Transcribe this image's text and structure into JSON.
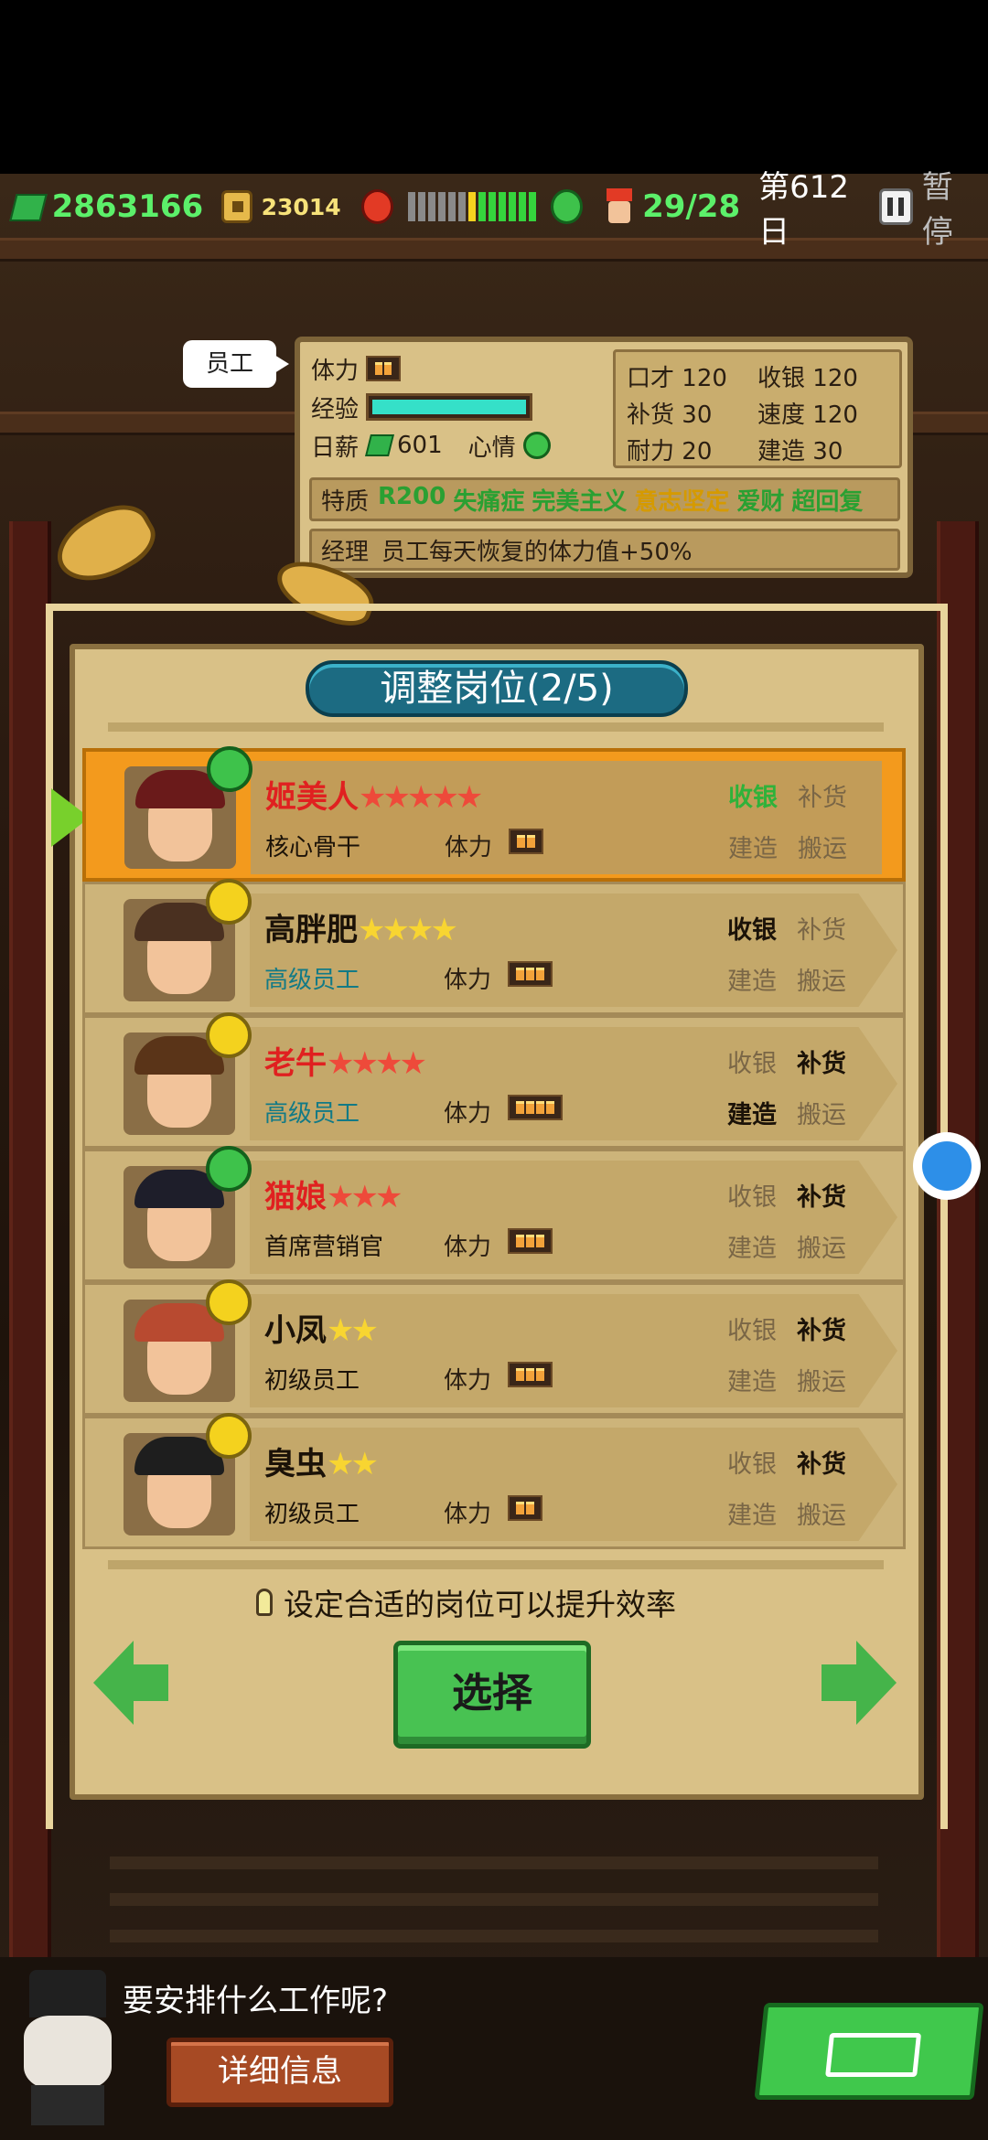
{
  "hud": {
    "money": "2863166",
    "coins": "23014",
    "staff_count": "29/28",
    "day": "第612日",
    "pause_label": "暂停"
  },
  "staff_tag": "员工",
  "info": {
    "stamina_label": "体力",
    "exp_label": "经验",
    "exp_fraction": 1.0,
    "salary_label": "日薪",
    "salary": "601",
    "mood_label": "心情",
    "stats": [
      {
        "label": "口才",
        "value": "120"
      },
      {
        "label": "收银",
        "value": "120"
      },
      {
        "label": "补货",
        "value": "30"
      },
      {
        "label": "速度",
        "value": "120"
      },
      {
        "label": "耐力",
        "value": "20"
      },
      {
        "label": "建造",
        "value": "30"
      }
    ],
    "traits_label": "特质",
    "traits": [
      {
        "text": "R200",
        "color": "#2aa032"
      },
      {
        "text": "失痛症",
        "color": "#2aa032"
      },
      {
        "text": "完美主义",
        "color": "#2aa032"
      },
      {
        "text": "意志坚定",
        "color": "#d59a00"
      },
      {
        "text": "爱财",
        "color": "#2aa032"
      },
      {
        "text": "超回复",
        "color": "#2aa032"
      }
    ],
    "manager_label": "经理",
    "manager_text": "员工每天恢复的体力值+50%"
  },
  "panel": {
    "title": "调整岗位(2/5)",
    "hint": "设定合适的岗位可以提升效率",
    "select_label": "选择"
  },
  "stamina_label": "体力",
  "jobs": [
    "收银",
    "补货",
    "建造",
    "搬运"
  ],
  "employees": [
    {
      "name": "姬美人",
      "name_color": "#e02020",
      "stars": "★★★★★",
      "star_color": "red",
      "rank": "核心骨干",
      "rank_color": "#1b1208",
      "stamina": 2,
      "mood": "happy",
      "active": [
        "on-green",
        "",
        "",
        ""
      ],
      "hair": "#6a1a1a"
    },
    {
      "name": "高胖肥",
      "name_color": "#1b1208",
      "stars": "★★★★",
      "star_color": "yellow",
      "rank": "高级员工",
      "rank_color": "#127a86",
      "stamina": 3,
      "mood": "neutral",
      "active": [
        "on",
        "",
        "",
        ""
      ],
      "hair": "#4a3020"
    },
    {
      "name": "老牛",
      "name_color": "#e02020",
      "stars": "★★★★",
      "star_color": "red",
      "rank": "高级员工",
      "rank_color": "#127a86",
      "stamina": 4,
      "mood": "neutral",
      "active": [
        "",
        "on",
        "on",
        ""
      ],
      "hair": "#5a3418"
    },
    {
      "name": "猫娘",
      "name_color": "#e02020",
      "stars": "★★★",
      "star_color": "red",
      "rank": "首席营销官",
      "rank_color": "#1b1208",
      "stamina": 3,
      "mood": "happy",
      "active": [
        "",
        "on",
        "",
        ""
      ],
      "hair": "#1e1e2a"
    },
    {
      "name": "小凤",
      "name_color": "#1b1208",
      "stars": "★★",
      "star_color": "yellow",
      "rank": "初级员工",
      "rank_color": "#1b1208",
      "stamina": 3,
      "mood": "neutral",
      "active": [
        "",
        "on",
        "",
        ""
      ],
      "hair": "#b84a30"
    },
    {
      "name": "臭虫",
      "name_color": "#1b1208",
      "stars": "★★",
      "star_color": "yellow",
      "rank": "初级员工",
      "rank_color": "#1b1208",
      "stamina": 2,
      "mood": "neutral",
      "active": [
        "",
        "on",
        "",
        ""
      ],
      "hair": "#1e1e1e"
    }
  ],
  "bottom": {
    "dialogue": "要安排什么工作呢?",
    "detail_label": "详细信息"
  }
}
